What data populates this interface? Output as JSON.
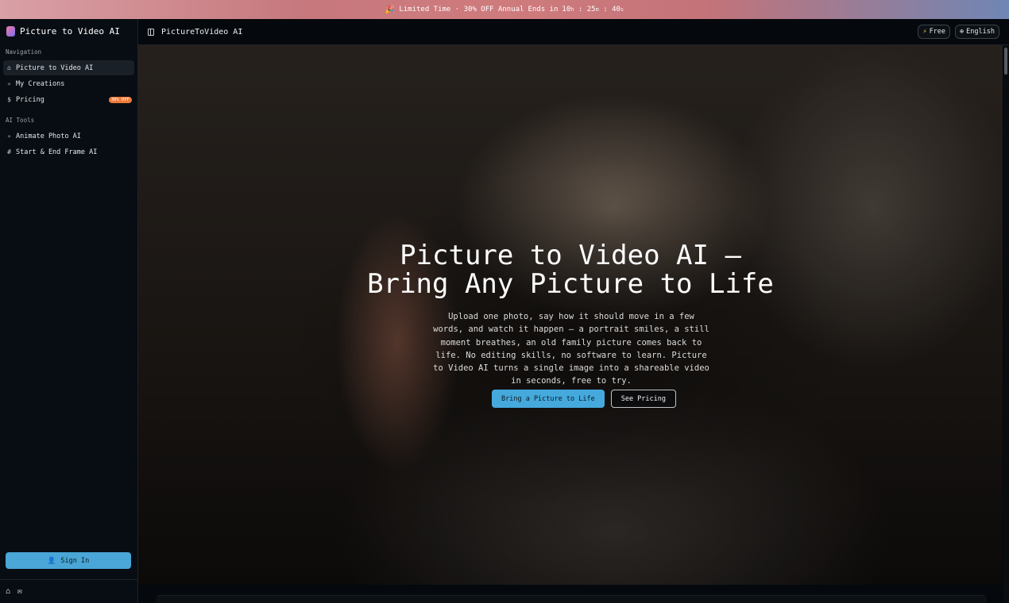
{
  "banner": {
    "icon": "party-popper-icon",
    "label": "Limited Time · 30% OFF Annual",
    "ends_in": "Ends in",
    "hours": "10",
    "hours_unit": "h",
    "minutes": "25",
    "minutes_unit": "m",
    "seconds": "40",
    "seconds_unit": "s"
  },
  "sidebar": {
    "brand": "Picture to Video AI",
    "nav_label": "Navigation",
    "nav_items": [
      {
        "label": "Picture to Video AI",
        "icon": "home-icon",
        "active": true
      },
      {
        "label": "My Creations",
        "icon": "wand-icon"
      },
      {
        "label": "Pricing",
        "icon": "dollar-icon",
        "badge": "30% OFF"
      }
    ],
    "tools_label": "AI Tools",
    "tool_items": [
      {
        "label": "Animate Photo AI",
        "icon": "wand-icon"
      },
      {
        "label": "Start & End Frame AI",
        "icon": "frame-icon"
      }
    ],
    "sign_in": "Sign In"
  },
  "topbar": {
    "title": "PictureToVideo AI",
    "free": "Free",
    "language": "English"
  },
  "hero": {
    "title_line1": "Picture to Video AI —",
    "title_line2": "Bring Any Picture to Life",
    "description": "Upload one photo, say how it should move in a few words, and watch it happen — a portrait smiles, a still moment breathes, an old family picture comes back to life. No editing skills, no software to learn. Picture to Video AI turns a single image into a shareable video in seconds, free to try.",
    "primary_button": "Bring a Picture to Life",
    "secondary_button": "See Pricing"
  },
  "colors": {
    "accent": "#45a9dc",
    "badge": "#ee7a3a",
    "sidebar_bg": "#080d13"
  }
}
